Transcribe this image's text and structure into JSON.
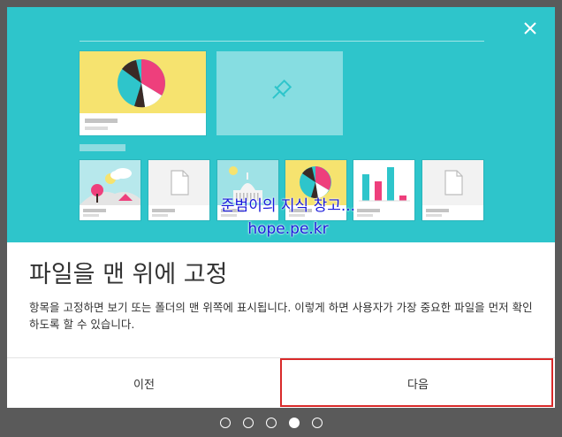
{
  "dialog": {
    "title": "파일을 맨 위에 고정",
    "description": "항목을 고정하면 보기 또는 폴더의 맨 위쪽에 표시됩니다. 이렇게 하면 사용자가 가장 중요한 파일을 먼저 확인하도록 할 수 있습니다.",
    "close_icon": "close-icon",
    "prev_label": "이전",
    "next_label": "다음"
  },
  "watermark": {
    "line1": "준범이의 지식 창고...",
    "line2": "hope.pe.kr"
  },
  "pager": {
    "total": 5,
    "active_index": 3
  },
  "colors": {
    "hero_bg": "#2ec5cb",
    "card_yellow": "#f6e36f",
    "pie_pink": "#ee3f7c",
    "pie_teal": "#2ec5cb",
    "pie_dark": "#3a2a26",
    "highlight_red": "#d92a2a"
  }
}
